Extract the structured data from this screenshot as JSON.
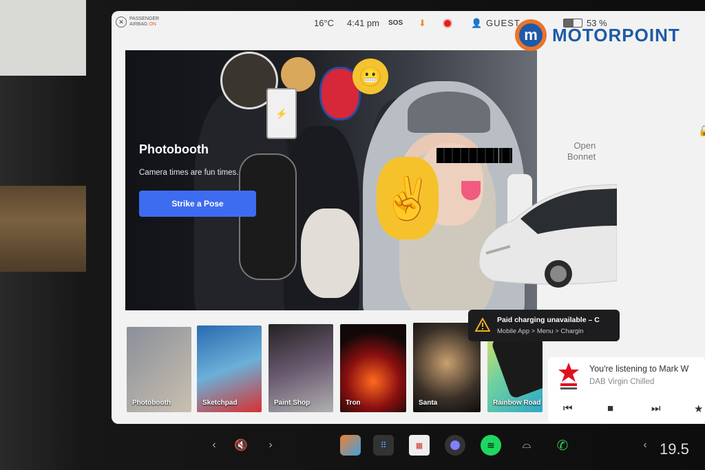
{
  "status_bar": {
    "airbag_label": "PASSENGER",
    "airbag_label2": "AIRBAG",
    "airbag_state": "ON",
    "temperature": "16°C",
    "time": "4:41 pm",
    "sos": "SOS",
    "user": "GUEST",
    "battery": "53 %",
    "battery_level": 0.53
  },
  "watermark": {
    "brand": "MOTORPOINT",
    "mark": "m"
  },
  "hero": {
    "title": "Photobooth",
    "subtitle": "Camera times are fun times.",
    "cta": "Strike a Pose"
  },
  "apps": [
    {
      "label": "Photobooth"
    },
    {
      "label": "Sketchpad"
    },
    {
      "label": "Paint Shop"
    },
    {
      "label": "Tron"
    },
    {
      "label": "Santa"
    },
    {
      "label": "Rainbow Road"
    }
  ],
  "vehicle": {
    "bonnet_l1": "Open",
    "bonnet_l2": "Bonnet"
  },
  "notice": {
    "title": "Paid charging unavailable – C",
    "subtitle": "Mobile App > Menu > Chargin"
  },
  "media": {
    "line1": "You're listening to Mark W",
    "line2": "DAB Virgin Chilled"
  },
  "dock": {
    "cabin_temp": "19.5"
  },
  "colors": {
    "accent_button": "#3e6cf0",
    "brand_blue": "#1e5aa8",
    "brand_orange": "#e8742a"
  }
}
